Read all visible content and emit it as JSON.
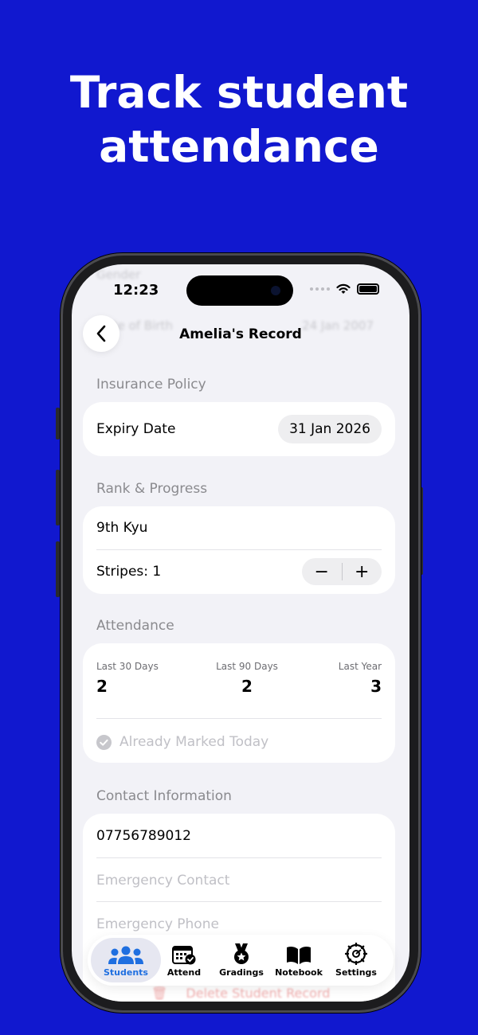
{
  "headline": {
    "line1": "Track student",
    "line2": "attendance"
  },
  "status_bar": {
    "time": "12:23"
  },
  "background_rows": {
    "gender_label": "Gender",
    "dob_label": "Date of Birth",
    "dob_value": "24 Jan 2007"
  },
  "nav": {
    "back_icon": "chevron-left-icon",
    "title": "Amelia's Record"
  },
  "insurance": {
    "section": "Insurance Policy",
    "expiry_label": "Expiry Date",
    "expiry_value": "31 Jan 2026"
  },
  "rank": {
    "section": "Rank & Progress",
    "rank_value": "9th Kyu",
    "stripes_label": "Stripes: 1",
    "decrement": "−",
    "increment": "+"
  },
  "attendance": {
    "section": "Attendance",
    "stats": [
      {
        "label": "Last 30 Days",
        "value": "2"
      },
      {
        "label": "Last 90 Days",
        "value": "2"
      },
      {
        "label": "Last Year",
        "value": "3"
      }
    ],
    "marked_label": "Already Marked Today"
  },
  "contact": {
    "section": "Contact Information",
    "phone": "07756789012",
    "emergency_contact_placeholder": "Emergency Contact",
    "emergency_phone_placeholder": "Emergency Phone"
  },
  "delete_label": "Delete Student Record",
  "tabbar": {
    "tabs": [
      {
        "label": "Students",
        "icon": "people-icon",
        "active": true
      },
      {
        "label": "Attend",
        "icon": "calendar-check-icon",
        "active": false
      },
      {
        "label": "Gradings",
        "icon": "medal-icon",
        "active": false
      },
      {
        "label": "Notebook",
        "icon": "book-icon",
        "active": false
      },
      {
        "label": "Settings",
        "icon": "gear-icon",
        "active": false
      }
    ]
  },
  "colors": {
    "background": "#1118CF",
    "accent": "#1F6FE0",
    "screen_bg": "#F2F2F7",
    "card_bg": "#FFFFFF",
    "destructive": "#F2B0B0"
  }
}
